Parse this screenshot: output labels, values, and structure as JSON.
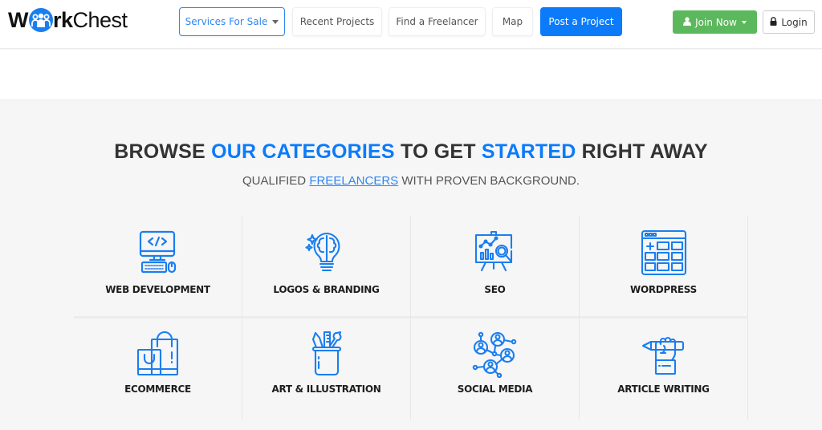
{
  "brand": {
    "logo_prefix": "W",
    "logo_middle": "rk",
    "logo_suffix": "Chest",
    "accent_color": "#0b7bfa"
  },
  "nav": {
    "services_label": "Services For Sale",
    "recent_label": "Recent Projects",
    "find_label": "Find a Freelancer",
    "map_label": "Map",
    "post_label": "Post a Project",
    "join_label": "Join Now",
    "login_label": "Login"
  },
  "hero": {
    "headline_parts": [
      "BROWSE ",
      "OUR CATEGORIES",
      " TO GET ",
      "STARTED",
      " RIGHT AWAY"
    ],
    "sub_prefix": "QUALIFIED ",
    "sub_link": "FREELANCERS",
    "sub_suffix": " WITH PROVEN BACKGROUND."
  },
  "categories": [
    {
      "label": "WEB DEVELOPMENT",
      "icon": "computer-code-icon"
    },
    {
      "label": "LOGOS & BRANDING",
      "icon": "brain-bulb-icon"
    },
    {
      "label": "SEO",
      "icon": "presentation-magnifier-icon"
    },
    {
      "label": "WORDPRESS",
      "icon": "website-grid-icon"
    },
    {
      "label": "ECOMMERCE",
      "icon": "shopping-bags-icon"
    },
    {
      "label": "ART & ILLUSTRATION",
      "icon": "pencil-cup-icon"
    },
    {
      "label": "SOCIAL MEDIA",
      "icon": "people-network-icon"
    },
    {
      "label": "ARTICLE WRITING",
      "icon": "hand-pen-icon"
    }
  ]
}
